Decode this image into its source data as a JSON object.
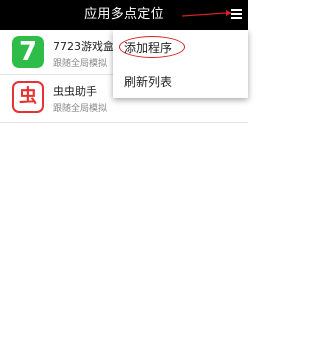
{
  "header": {
    "title": "应用多点定位",
    "menu_icon": "menu-icon",
    "annotation_color": "#d42020"
  },
  "apps": [
    {
      "name": "7723游戏盒",
      "subtitle": "跟随全局模拟",
      "icon": "app-7723-icon",
      "icon_glyph": "7",
      "icon_color": "#2fbd4a"
    },
    {
      "name": "虫虫助手",
      "subtitle": "跟随全局模拟",
      "icon": "app-chongchong-icon",
      "icon_glyph": "虫",
      "icon_color": "#e63232"
    }
  ],
  "menu": {
    "items": [
      {
        "label": "添加程序"
      },
      {
        "label": "刷新列表"
      }
    ]
  }
}
